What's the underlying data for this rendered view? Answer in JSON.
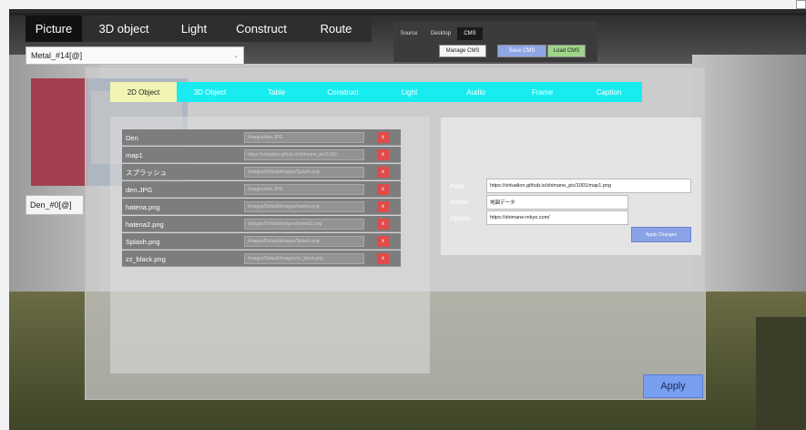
{
  "top_tabs": [
    {
      "label": "Picture",
      "active": true
    },
    {
      "label": "3D object",
      "active": false
    },
    {
      "label": "Light",
      "active": false
    },
    {
      "label": "Construct",
      "active": false
    },
    {
      "label": "Route",
      "active": false
    }
  ],
  "dropdown": {
    "value": "Metal_#14[@]"
  },
  "left_label": {
    "value": "Den_#0[@]"
  },
  "cms": {
    "tabs": [
      {
        "label": "Source",
        "active": false
      },
      {
        "label": "Desktop",
        "active": false
      },
      {
        "label": "CMS",
        "active": true
      }
    ],
    "manage_label": "Manage CMS",
    "save_label": "Save CMS",
    "load_label": "Load CMS"
  },
  "main_tabs": [
    {
      "label": "2D Object",
      "active": true
    },
    {
      "label": "3D Object",
      "active": false
    },
    {
      "label": "Table",
      "active": false
    },
    {
      "label": "Construct",
      "active": false
    },
    {
      "label": "Light",
      "active": false
    },
    {
      "label": "Audio",
      "active": false
    },
    {
      "label": "Frame",
      "active": false
    },
    {
      "label": "Caption",
      "active": false
    }
  ],
  "items": [
    {
      "name": "Den",
      "path": "/images/den.JPG",
      "delete": "x"
    },
    {
      "name": "map1",
      "path": "https://virtualion.github.io/shimane_pic/1001/",
      "delete": "x"
    },
    {
      "name": "スプラッシュ",
      "path": "/images/Default/images/Splash.png",
      "delete": "x"
    },
    {
      "name": "den.JPG",
      "path": "/images/den.JPG",
      "delete": "x"
    },
    {
      "name": "hatena.png",
      "path": "/images/Default/images/hatena.png",
      "delete": "x"
    },
    {
      "name": "hatena2.png",
      "path": "/images/Default/images/hatena2.png",
      "delete": "x"
    },
    {
      "name": "Splash.png",
      "path": "/images/Default/images/Splash.png",
      "delete": "x"
    },
    {
      "name": "zz_black.png",
      "path": "/images/Default/images/zz_black.png",
      "delete": "x"
    }
  ],
  "details": {
    "path_label": "Path",
    "path_value": "https://virtualion.github.io/shimane_pic/1001/map1.png",
    "name_label": "Name",
    "name_value": "地図データ",
    "option_label": "Option",
    "option_value": "https://shimane-mkyo.com/",
    "apply_changes_label": "Apply Changes"
  },
  "apply_label": "Apply",
  "colors": {
    "accent_cyan": "#19ecf0",
    "active_tab": "#f1f4b4",
    "delete_red": "#e14b4b",
    "apply_blue": "#789ef0",
    "save_blue": "#8fa6e6",
    "load_green": "#9fd58a"
  }
}
